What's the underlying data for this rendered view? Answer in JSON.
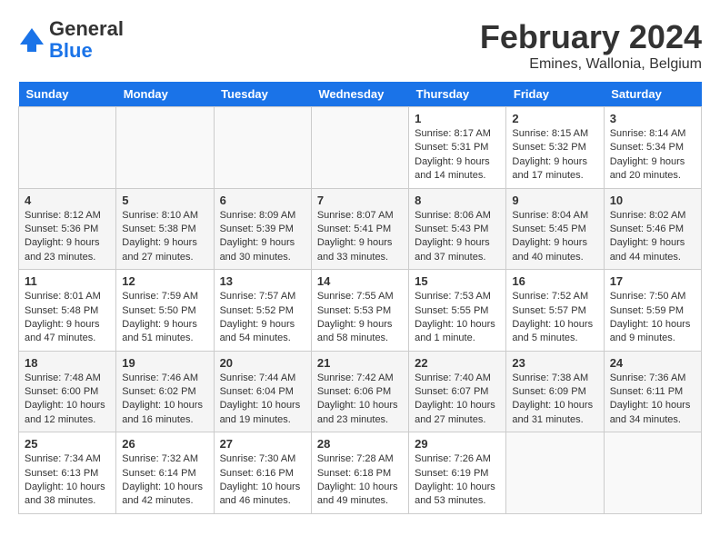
{
  "logo": {
    "line1": "General",
    "line2": "Blue"
  },
  "title": "February 2024",
  "subtitle": "Emines, Wallonia, Belgium",
  "days_of_week": [
    "Sunday",
    "Monday",
    "Tuesday",
    "Wednesday",
    "Thursday",
    "Friday",
    "Saturday"
  ],
  "weeks": [
    [
      {
        "day": "",
        "info": ""
      },
      {
        "day": "",
        "info": ""
      },
      {
        "day": "",
        "info": ""
      },
      {
        "day": "",
        "info": ""
      },
      {
        "day": "1",
        "info": "Sunrise: 8:17 AM\nSunset: 5:31 PM\nDaylight: 9 hours\nand 14 minutes."
      },
      {
        "day": "2",
        "info": "Sunrise: 8:15 AM\nSunset: 5:32 PM\nDaylight: 9 hours\nand 17 minutes."
      },
      {
        "day": "3",
        "info": "Sunrise: 8:14 AM\nSunset: 5:34 PM\nDaylight: 9 hours\nand 20 minutes."
      }
    ],
    [
      {
        "day": "4",
        "info": "Sunrise: 8:12 AM\nSunset: 5:36 PM\nDaylight: 9 hours\nand 23 minutes."
      },
      {
        "day": "5",
        "info": "Sunrise: 8:10 AM\nSunset: 5:38 PM\nDaylight: 9 hours\nand 27 minutes."
      },
      {
        "day": "6",
        "info": "Sunrise: 8:09 AM\nSunset: 5:39 PM\nDaylight: 9 hours\nand 30 minutes."
      },
      {
        "day": "7",
        "info": "Sunrise: 8:07 AM\nSunset: 5:41 PM\nDaylight: 9 hours\nand 33 minutes."
      },
      {
        "day": "8",
        "info": "Sunrise: 8:06 AM\nSunset: 5:43 PM\nDaylight: 9 hours\nand 37 minutes."
      },
      {
        "day": "9",
        "info": "Sunrise: 8:04 AM\nSunset: 5:45 PM\nDaylight: 9 hours\nand 40 minutes."
      },
      {
        "day": "10",
        "info": "Sunrise: 8:02 AM\nSunset: 5:46 PM\nDaylight: 9 hours\nand 44 minutes."
      }
    ],
    [
      {
        "day": "11",
        "info": "Sunrise: 8:01 AM\nSunset: 5:48 PM\nDaylight: 9 hours\nand 47 minutes."
      },
      {
        "day": "12",
        "info": "Sunrise: 7:59 AM\nSunset: 5:50 PM\nDaylight: 9 hours\nand 51 minutes."
      },
      {
        "day": "13",
        "info": "Sunrise: 7:57 AM\nSunset: 5:52 PM\nDaylight: 9 hours\nand 54 minutes."
      },
      {
        "day": "14",
        "info": "Sunrise: 7:55 AM\nSunset: 5:53 PM\nDaylight: 9 hours\nand 58 minutes."
      },
      {
        "day": "15",
        "info": "Sunrise: 7:53 AM\nSunset: 5:55 PM\nDaylight: 10 hours\nand 1 minute."
      },
      {
        "day": "16",
        "info": "Sunrise: 7:52 AM\nSunset: 5:57 PM\nDaylight: 10 hours\nand 5 minutes."
      },
      {
        "day": "17",
        "info": "Sunrise: 7:50 AM\nSunset: 5:59 PM\nDaylight: 10 hours\nand 9 minutes."
      }
    ],
    [
      {
        "day": "18",
        "info": "Sunrise: 7:48 AM\nSunset: 6:00 PM\nDaylight: 10 hours\nand 12 minutes."
      },
      {
        "day": "19",
        "info": "Sunrise: 7:46 AM\nSunset: 6:02 PM\nDaylight: 10 hours\nand 16 minutes."
      },
      {
        "day": "20",
        "info": "Sunrise: 7:44 AM\nSunset: 6:04 PM\nDaylight: 10 hours\nand 19 minutes."
      },
      {
        "day": "21",
        "info": "Sunrise: 7:42 AM\nSunset: 6:06 PM\nDaylight: 10 hours\nand 23 minutes."
      },
      {
        "day": "22",
        "info": "Sunrise: 7:40 AM\nSunset: 6:07 PM\nDaylight: 10 hours\nand 27 minutes."
      },
      {
        "day": "23",
        "info": "Sunrise: 7:38 AM\nSunset: 6:09 PM\nDaylight: 10 hours\nand 31 minutes."
      },
      {
        "day": "24",
        "info": "Sunrise: 7:36 AM\nSunset: 6:11 PM\nDaylight: 10 hours\nand 34 minutes."
      }
    ],
    [
      {
        "day": "25",
        "info": "Sunrise: 7:34 AM\nSunset: 6:13 PM\nDaylight: 10 hours\nand 38 minutes."
      },
      {
        "day": "26",
        "info": "Sunrise: 7:32 AM\nSunset: 6:14 PM\nDaylight: 10 hours\nand 42 minutes."
      },
      {
        "day": "27",
        "info": "Sunrise: 7:30 AM\nSunset: 6:16 PM\nDaylight: 10 hours\nand 46 minutes."
      },
      {
        "day": "28",
        "info": "Sunrise: 7:28 AM\nSunset: 6:18 PM\nDaylight: 10 hours\nand 49 minutes."
      },
      {
        "day": "29",
        "info": "Sunrise: 7:26 AM\nSunset: 6:19 PM\nDaylight: 10 hours\nand 53 minutes."
      },
      {
        "day": "",
        "info": ""
      },
      {
        "day": "",
        "info": ""
      }
    ]
  ]
}
